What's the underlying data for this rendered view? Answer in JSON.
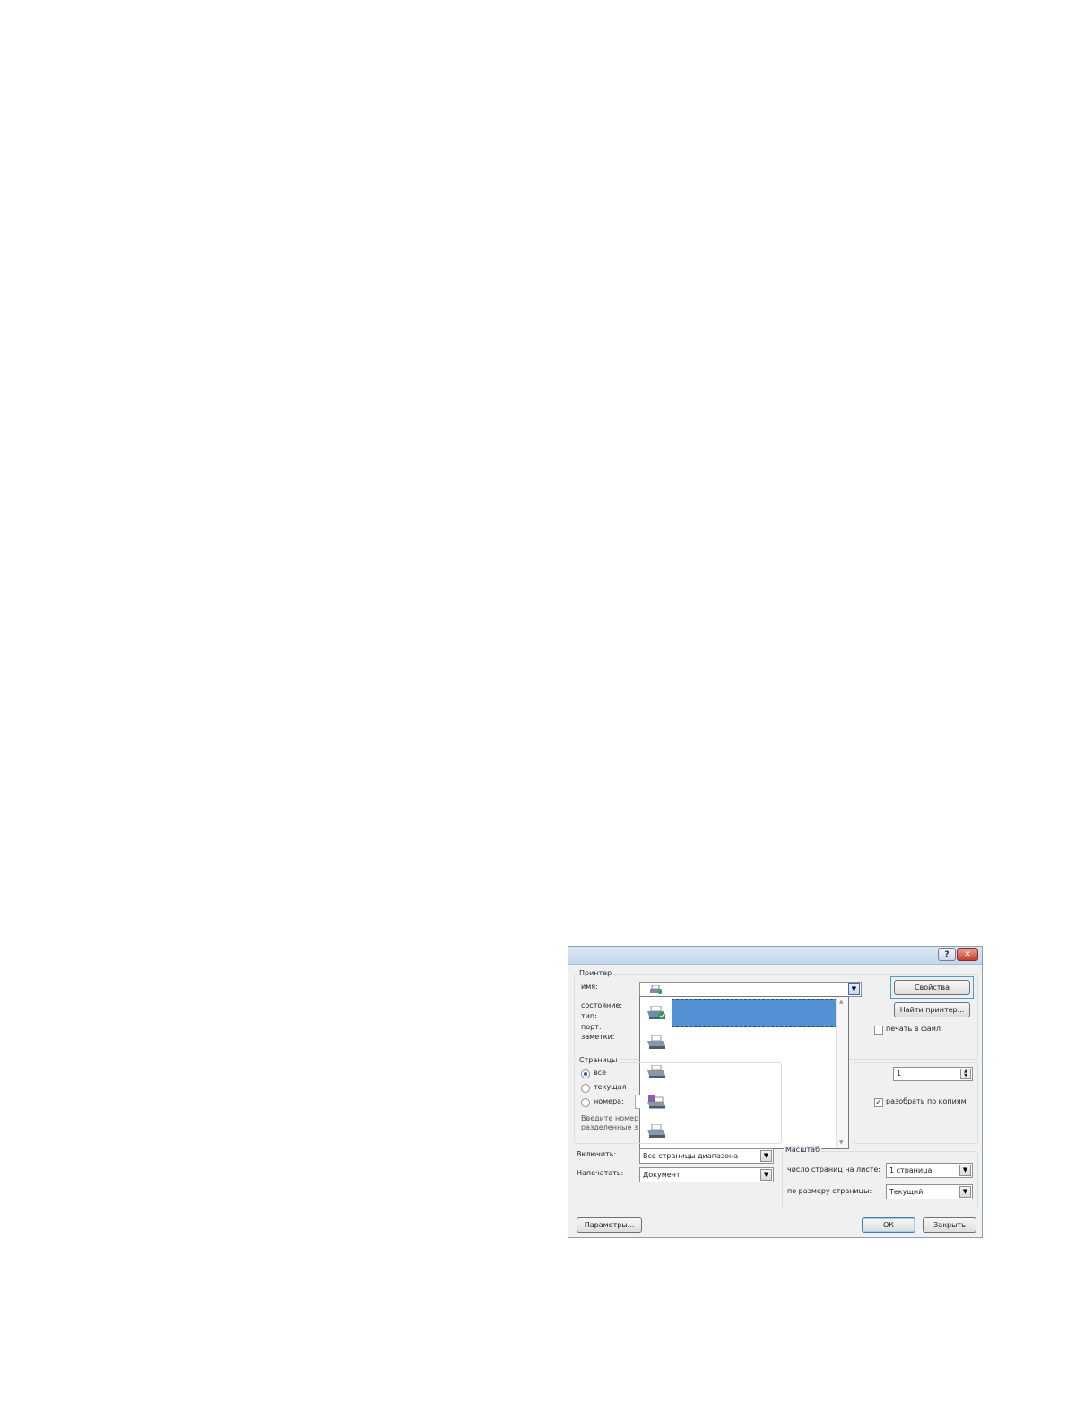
{
  "dialog": {
    "help_glyph": "?",
    "close_glyph": "✕",
    "colors": {
      "selection": "#5291d3",
      "frame": "#8a9eb8",
      "close": "#c3402a"
    }
  },
  "printer": {
    "legend": "Принтер",
    "name_label": "имя:",
    "status_label": "состояние:",
    "type_label": "тип:",
    "port_label": "порт:",
    "notes_label": "заметки:",
    "properties_button": "Свойства",
    "find_printer_button": "Найти принтер...",
    "print_to_file_label": "печать в файл",
    "print_to_file_checked": false,
    "dropdown_items": [
      {
        "icon": "printer-default-icon",
        "selected": true
      },
      {
        "icon": "printer-icon",
        "selected": false
      },
      {
        "icon": "printer-icon",
        "selected": false
      },
      {
        "icon": "fax-icon",
        "selected": false
      },
      {
        "icon": "printer-icon",
        "selected": false
      }
    ]
  },
  "pages": {
    "legend": "Страницы",
    "all_label": "все",
    "current_label": "текущая",
    "numbers_label": "номера:",
    "selected": "all",
    "hint_line1": "Введите номер",
    "hint_line2": "разделенные з"
  },
  "copies": {
    "count": "1",
    "collate_label": "разобрать по копиям",
    "collate_checked": true
  },
  "include": {
    "label": "Включить:",
    "value": "Все страницы диапазона"
  },
  "print_what": {
    "label": "Напечатать:",
    "value": "Документ"
  },
  "scale": {
    "legend": "Масштаб",
    "pages_per_sheet_label": "число страниц на листе:",
    "pages_per_sheet_value": "1 страница",
    "fit_label": "по размеру страницы:",
    "fit_value": "Текущий"
  },
  "footer": {
    "options_button": "Параметры...",
    "ok_button": "ОК",
    "close_button": "Закрыть"
  }
}
